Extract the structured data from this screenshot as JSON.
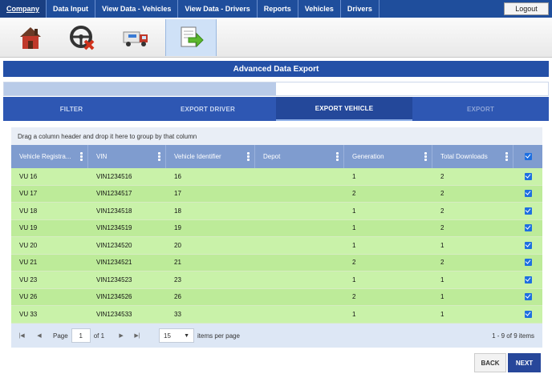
{
  "nav": {
    "tabs": [
      {
        "label": "Company"
      },
      {
        "label": "Data Input"
      },
      {
        "label": "View Data - Vehicles"
      },
      {
        "label": "View Data - Drivers"
      },
      {
        "label": "Reports"
      },
      {
        "label": "Vehicles"
      },
      {
        "label": "Drivers"
      }
    ],
    "logout_label": "Logout"
  },
  "toolbar": {
    "icons": [
      "house-icon",
      "steering-wheel-delete-icon",
      "truck-icon",
      "document-export-icon"
    ]
  },
  "panel": {
    "title": "Advanced Data Export"
  },
  "wizard": {
    "progress_fraction": 0.5,
    "steps": [
      "FILTER",
      "EXPORT DRIVER",
      "EXPORT VEHICLE",
      "EXPORT"
    ],
    "current_step": 2
  },
  "grid": {
    "group_hint": "Drag a column header and drop it here to group by that column",
    "columns": [
      "Vehicle Registra...",
      "VIN",
      "Vehicle Identifier",
      "Depot",
      "Generation",
      "Total Downloads"
    ],
    "rows": [
      {
        "reg": "VU 16",
        "vin": "VIN1234516",
        "id": "16",
        "depot": "",
        "gen": "1",
        "downloads": "2",
        "checked": true
      },
      {
        "reg": "VU 17",
        "vin": "VIN1234517",
        "id": "17",
        "depot": "",
        "gen": "2",
        "downloads": "2",
        "checked": true
      },
      {
        "reg": "VU 18",
        "vin": "VIN1234518",
        "id": "18",
        "depot": "",
        "gen": "1",
        "downloads": "2",
        "checked": true
      },
      {
        "reg": "VU 19",
        "vin": "VIN1234519",
        "id": "19",
        "depot": "",
        "gen": "1",
        "downloads": "2",
        "checked": true
      },
      {
        "reg": "VU 20",
        "vin": "VIN1234520",
        "id": "20",
        "depot": "",
        "gen": "1",
        "downloads": "1",
        "checked": true
      },
      {
        "reg": "VU 21",
        "vin": "VIN1234521",
        "id": "21",
        "depot": "",
        "gen": "2",
        "downloads": "2",
        "checked": true
      },
      {
        "reg": "VU 23",
        "vin": "VIN1234523",
        "id": "23",
        "depot": "",
        "gen": "1",
        "downloads": "1",
        "checked": true
      },
      {
        "reg": "VU 26",
        "vin": "VIN1234526",
        "id": "26",
        "depot": "",
        "gen": "2",
        "downloads": "1",
        "checked": true
      },
      {
        "reg": "VU 33",
        "vin": "VIN1234533",
        "id": "33",
        "depot": "",
        "gen": "1",
        "downloads": "1",
        "checked": true
      }
    ]
  },
  "pager": {
    "page_label": "Page",
    "page_value": "1",
    "of_label": "of 1",
    "page_size": "15",
    "items_per_page_label": "items per page",
    "info": "1 - 9 of 9 items"
  },
  "footer": {
    "back_label": "BACK",
    "next_label": "NEXT"
  },
  "colors": {
    "nav": "#1f4e9c",
    "header": "#2450a7",
    "row_highlight": "#c9f2a9",
    "checkbox": "#1e6fe0"
  }
}
